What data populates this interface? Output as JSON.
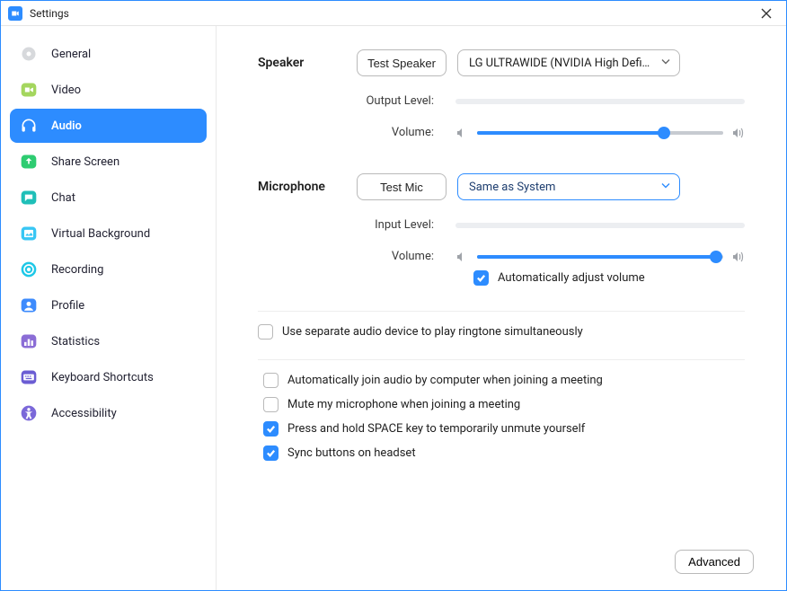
{
  "window": {
    "title": "Settings"
  },
  "sidebar": {
    "items": [
      {
        "label": "General"
      },
      {
        "label": "Video"
      },
      {
        "label": "Audio"
      },
      {
        "label": "Share Screen"
      },
      {
        "label": "Chat"
      },
      {
        "label": "Virtual Background"
      },
      {
        "label": "Recording"
      },
      {
        "label": "Profile"
      },
      {
        "label": "Statistics"
      },
      {
        "label": "Keyboard Shortcuts"
      },
      {
        "label": "Accessibility"
      }
    ]
  },
  "audio": {
    "speaker": {
      "heading": "Speaker",
      "test_label": "Test Speaker",
      "device": "LG ULTRAWIDE (NVIDIA High Defi…",
      "output_level_label": "Output Level:",
      "volume_label": "Volume:",
      "volume_percent": 76
    },
    "microphone": {
      "heading": "Microphone",
      "test_label": "Test Mic",
      "device": "Same as System",
      "input_level_label": "Input Level:",
      "volume_label": "Volume:",
      "volume_percent": 97,
      "auto_adjust_label": "Automatically adjust volume",
      "auto_adjust_checked": true
    },
    "ringtone": {
      "label": "Use separate audio device to play ringtone simultaneously",
      "checked": false
    },
    "options": [
      {
        "label": "Automatically join audio by computer when joining a meeting",
        "checked": false
      },
      {
        "label": "Mute my microphone when joining a meeting",
        "checked": false
      },
      {
        "label": "Press and hold SPACE key to temporarily unmute yourself",
        "checked": true
      },
      {
        "label": "Sync buttons on headset",
        "checked": true
      }
    ],
    "advanced_label": "Advanced"
  }
}
